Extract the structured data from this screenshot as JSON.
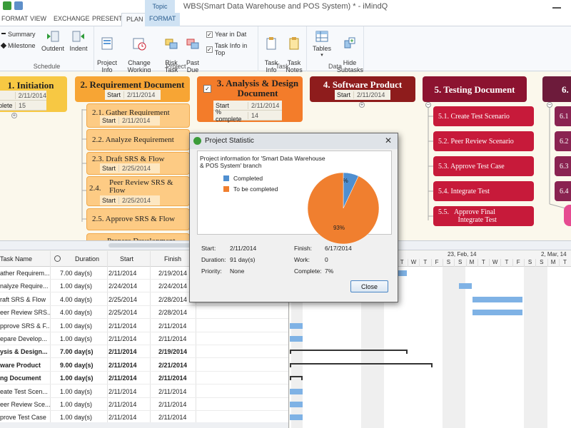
{
  "app": {
    "title": "WBS(Smart Data Warehouse and POS System) * - iMindQ",
    "context_tab": "Topic"
  },
  "ribbon_tabs": [
    "FORMAT",
    "VIEW",
    "EXCHANGE",
    "PRESENT",
    "PLAN",
    "FORMAT"
  ],
  "ribbon": {
    "schedule": {
      "summary": "Summary",
      "milestone": "Milestone",
      "outdent": "Outdent",
      "indent": "Indent",
      "label": "Schedule"
    },
    "project": {
      "project_info": "Project\nInfo",
      "change_working_time": "Change\nWorking Time",
      "risk_task": "Risk\nTask",
      "past_due": "Past\nDue",
      "year_in_date": "Year in Dat",
      "task_info_in_top": "Task Info in Top",
      "label": "Project"
    },
    "task": {
      "task_info": "Task\nInfo",
      "task_notes": "Task\nNotes",
      "label": "Task"
    },
    "data": {
      "tables": "Tables",
      "hide_subtasks": "Hide\nSubtasks",
      "label": "Data"
    }
  },
  "map": {
    "nodes": [
      {
        "label": "1.  Initiation",
        "start_key": "",
        "start": "2/11/2014",
        "pct_key": "plete",
        "pct": "15"
      },
      {
        "label": "2.  Requirement Document",
        "start_key": "Start",
        "start": "2/11/2014"
      },
      {
        "label": "3.   Analysis & Design Document",
        "start_key": "Start",
        "start": "2/11/2014",
        "pct_key": "% complete",
        "pct": "14"
      },
      {
        "label": "4.  Software Product",
        "start_key": "Start",
        "start": "2/11/2014"
      },
      {
        "label": "5.  Testing Document"
      },
      {
        "label": "6."
      }
    ],
    "req_subs": [
      {
        "label": "2.1.  Gather Requirement",
        "start_key": "Start",
        "start": "2/11/2014"
      },
      {
        "label": "2.2.  Analyze Requirement"
      },
      {
        "label": "2.3.  Draft SRS & Flow",
        "start_key": "Start",
        "start": "2/25/2014"
      },
      {
        "label": "2.4.",
        "label2": "Peer Review SRS &",
        "label3": "Flow",
        "start_key": "Start",
        "start": "2/25/2014"
      },
      {
        "label": "2.5.  Approve SRS & Flow"
      },
      {
        "label": "Prepare Development"
      }
    ],
    "test_subs": [
      "5.1.   Create Test Scenario",
      "5.2.   Peer Review Scenario",
      "5.3.   Approve Test Case",
      "5.4.   Integrate Test",
      "5.5.   Approve Final\n           Integrate Test"
    ],
    "six_subs": [
      "6.1",
      "6.2",
      "6.3",
      "6.4"
    ]
  },
  "grid": {
    "headers": {
      "name": "Task Name",
      "duration": "Duration",
      "start": "Start",
      "finish": "Finish"
    },
    "rows": [
      {
        "name": "ather Requirem...",
        "duration": "7.00 day(s)",
        "start": "2/11/2014",
        "finish": "2/19/2014",
        "bold": false
      },
      {
        "name": "nalyze Require...",
        "duration": "1.00 day(s)",
        "start": "2/24/2014",
        "finish": "2/24/2014",
        "bold": false
      },
      {
        "name": "raft SRS & Flow",
        "duration": "4.00 day(s)",
        "start": "2/25/2014",
        "finish": "2/28/2014",
        "bold": false
      },
      {
        "name": "eer Review SRS...",
        "duration": "4.00 day(s)",
        "start": "2/25/2014",
        "finish": "2/28/2014",
        "bold": false
      },
      {
        "name": "pprove SRS & F...",
        "duration": "1.00 day(s)",
        "start": "2/11/2014",
        "finish": "2/11/2014",
        "bold": false
      },
      {
        "name": "epare Develop...",
        "duration": "1.00 day(s)",
        "start": "2/11/2014",
        "finish": "2/11/2014",
        "bold": false
      },
      {
        "name": "ysis & Design...",
        "duration": "7.00 day(s)",
        "start": "2/11/2014",
        "finish": "2/19/2014",
        "bold": true
      },
      {
        "name": "ware Product",
        "duration": "9.00 day(s)",
        "start": "2/11/2014",
        "finish": "2/21/2014",
        "bold": true
      },
      {
        "name": "ng Document",
        "duration": "1.00 day(s)",
        "start": "2/11/2014",
        "finish": "2/11/2014",
        "bold": true
      },
      {
        "name": "eate Test Scen...",
        "duration": "1.00 day(s)",
        "start": "2/11/2014",
        "finish": "2/11/2014",
        "bold": false
      },
      {
        "name": "eer Review Sce...",
        "duration": "1.00 day(s)",
        "start": "2/11/2014",
        "finish": "2/11/2014",
        "bold": false
      },
      {
        "name": "prove Test Case",
        "duration": "1.00 day(s)",
        "start": "2/11/2014",
        "finish": "2/11/2014",
        "bold": false
      }
    ]
  },
  "gantt": {
    "week1": "23, Feb, 14",
    "week2": "2, Mar, 14",
    "days": [
      "S",
      "M",
      "T",
      "W",
      "T",
      "F",
      "S",
      "S",
      "M",
      "T",
      "W",
      "T",
      "F",
      "S",
      "S",
      "M",
      "T",
      "W",
      "T",
      "F",
      "S",
      "S",
      "M",
      "T"
    ]
  },
  "dialog": {
    "title": "Project Statistic",
    "info": "Project information for 'Smart Data Warehouse\n& POS System' branch",
    "legend_completed": "Completed",
    "legend_todo": "To be completed",
    "completed_color": "#4f8fd0",
    "todo_color": "#f07f2f",
    "pct_completed_label": "7%",
    "pct_todo_label": "93%",
    "start_label": "Start:",
    "start": "2/11/2014",
    "finish_label": "Finish:",
    "finish": "6/17/2014",
    "duration_label": "Duration:",
    "duration": "91 day(s)",
    "work_label": "Work:",
    "work": "0",
    "priority_label": "Priority:",
    "priority": "None",
    "complete_label": "Complete:",
    "complete": "7%",
    "close_label": "Close"
  },
  "chart_data": {
    "type": "pie",
    "categories": [
      "Completed",
      "To be completed"
    ],
    "values": [
      7,
      93
    ]
  }
}
